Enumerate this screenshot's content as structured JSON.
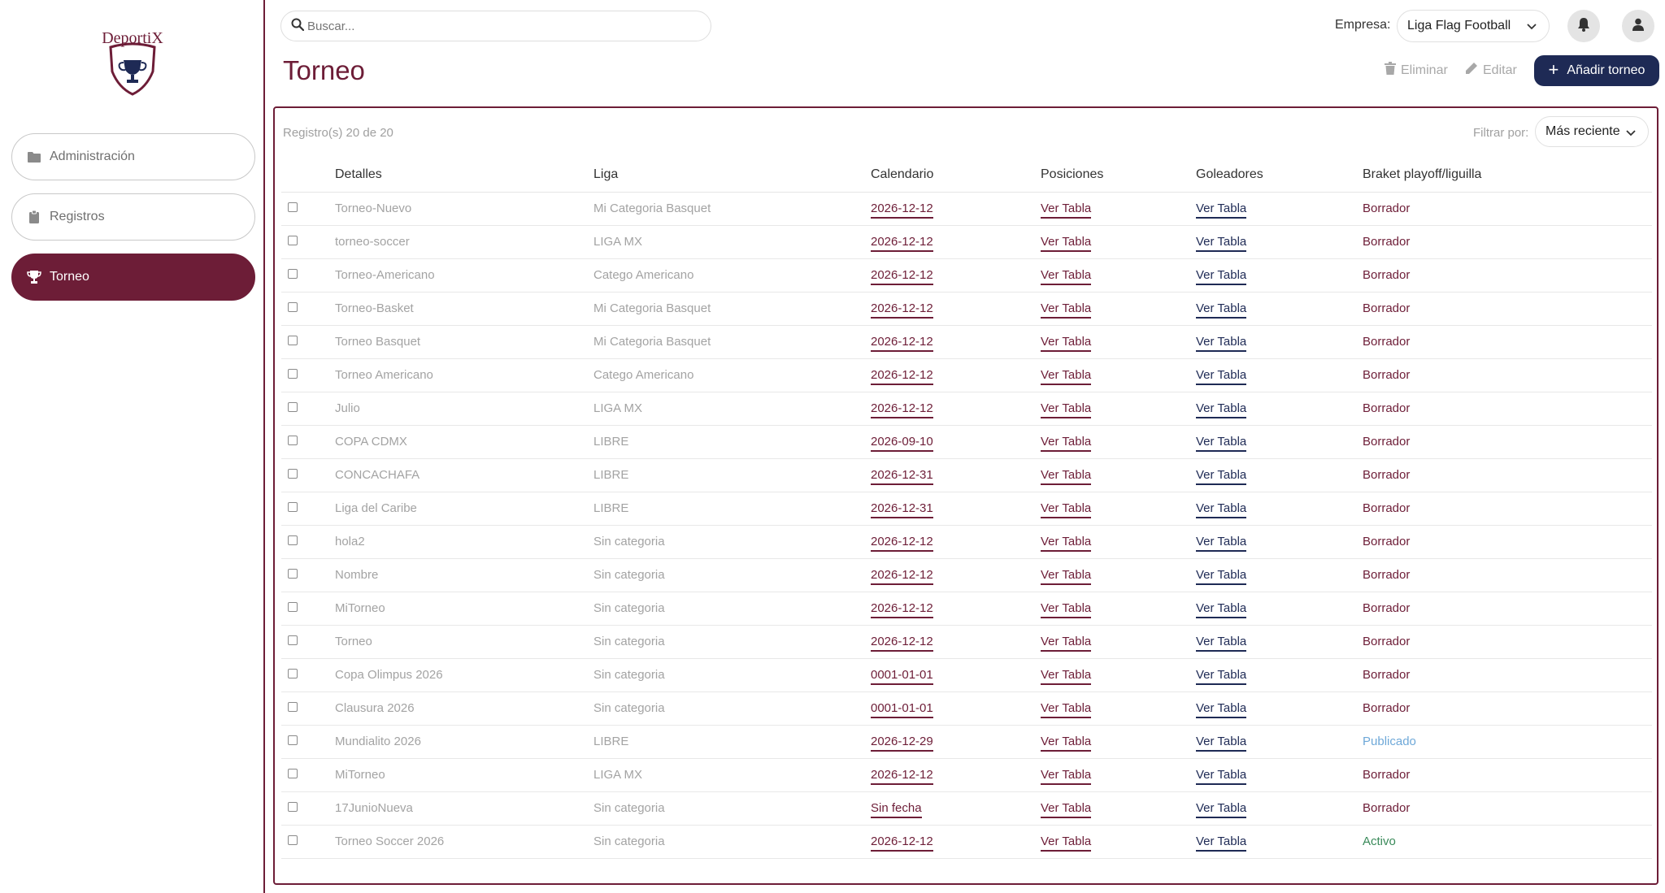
{
  "app": {
    "logo_text": "DeportiX"
  },
  "sidebar": {
    "items": [
      {
        "label": "Administración",
        "icon": "folder-icon"
      },
      {
        "label": "Registros",
        "icon": "clipboard-icon"
      },
      {
        "label": "Torneo",
        "icon": "trophy-icon"
      }
    ],
    "active": "Torneo"
  },
  "header": {
    "search_placeholder": "Buscar...",
    "empresa_label": "Empresa:",
    "empresa_value": "Liga Flag Football",
    "icons": [
      "bell-icon",
      "user-icon"
    ]
  },
  "page": {
    "title": "Torneo",
    "delete_label": "Eliminar",
    "edit_label": "Editar",
    "add_label": "Añadir torneo"
  },
  "table": {
    "count_text": "Registro(s) 20 de 20",
    "filter_label": "Filtrar por:",
    "filter_value": "Más reciente",
    "columns": [
      "Detalles",
      "Liga",
      "Calendario",
      "Posiciones",
      "Goleadores",
      "Braket playoff/liguilla"
    ],
    "rows": [
      {
        "detalles": "Torneo-Nuevo",
        "liga": "Mi Categoria Basquet",
        "calendario": "2026-12-12",
        "posiciones": "Ver Tabla",
        "goleadores": "Ver Tabla",
        "estado": "Borrador"
      },
      {
        "detalles": "torneo-soccer",
        "liga": "LIGA MX",
        "calendario": "2026-12-12",
        "posiciones": "Ver Tabla",
        "goleadores": "Ver Tabla",
        "estado": "Borrador"
      },
      {
        "detalles": "Torneo-Americano",
        "liga": "Catego Americano",
        "calendario": "2026-12-12",
        "posiciones": "Ver Tabla",
        "goleadores": "Ver Tabla",
        "estado": "Borrador"
      },
      {
        "detalles": "Torneo-Basket",
        "liga": "Mi Categoria Basquet",
        "calendario": "2026-12-12",
        "posiciones": "Ver Tabla",
        "goleadores": "Ver Tabla",
        "estado": "Borrador"
      },
      {
        "detalles": "Torneo Basquet",
        "liga": "Mi Categoria Basquet",
        "calendario": "2026-12-12",
        "posiciones": "Ver Tabla",
        "goleadores": "Ver Tabla",
        "estado": "Borrador"
      },
      {
        "detalles": "Torneo Americano",
        "liga": "Catego Americano",
        "calendario": "2026-12-12",
        "posiciones": "Ver Tabla",
        "goleadores": "Ver Tabla",
        "estado": "Borrador"
      },
      {
        "detalles": "Julio",
        "liga": "LIGA MX",
        "calendario": "2026-12-12",
        "posiciones": "Ver Tabla",
        "goleadores": "Ver Tabla",
        "estado": "Borrador"
      },
      {
        "detalles": "COPA CDMX",
        "liga": "LIBRE",
        "calendario": "2026-09-10",
        "posiciones": "Ver Tabla",
        "goleadores": "Ver Tabla",
        "estado": "Borrador"
      },
      {
        "detalles": "CONCACHAFA",
        "liga": "LIBRE",
        "calendario": "2026-12-31",
        "posiciones": "Ver Tabla",
        "goleadores": "Ver Tabla",
        "estado": "Borrador"
      },
      {
        "detalles": "Liga del Caribe",
        "liga": "LIBRE",
        "calendario": "2026-12-31",
        "posiciones": "Ver Tabla",
        "goleadores": "Ver Tabla",
        "estado": "Borrador"
      },
      {
        "detalles": "hola2",
        "liga": "Sin categoria",
        "calendario": "2026-12-12",
        "posiciones": "Ver Tabla",
        "goleadores": "Ver Tabla",
        "estado": "Borrador"
      },
      {
        "detalles": "Nombre",
        "liga": "Sin categoria",
        "calendario": "2026-12-12",
        "posiciones": "Ver Tabla",
        "goleadores": "Ver Tabla",
        "estado": "Borrador"
      },
      {
        "detalles": "MiTorneo",
        "liga": "Sin categoria",
        "calendario": "2026-12-12",
        "posiciones": "Ver Tabla",
        "goleadores": "Ver Tabla",
        "estado": "Borrador"
      },
      {
        "detalles": "Torneo",
        "liga": "Sin categoria",
        "calendario": "2026-12-12",
        "posiciones": "Ver Tabla",
        "goleadores": "Ver Tabla",
        "estado": "Borrador"
      },
      {
        "detalles": "Copa Olimpus 2026",
        "liga": "Sin categoria",
        "calendario": "0001-01-01",
        "posiciones": "Ver Tabla",
        "goleadores": "Ver Tabla",
        "estado": "Borrador"
      },
      {
        "detalles": "Clausura 2026",
        "liga": "Sin categoria",
        "calendario": "0001-01-01",
        "posiciones": "Ver Tabla",
        "goleadores": "Ver Tabla",
        "estado": "Borrador"
      },
      {
        "detalles": "Mundialito 2026",
        "liga": "LIBRE",
        "calendario": "2026-12-29",
        "posiciones": "Ver Tabla",
        "goleadores": "Ver Tabla",
        "estado": "Publicado"
      },
      {
        "detalles": "MiTorneo",
        "liga": "LIGA MX",
        "calendario": "2026-12-12",
        "posiciones": "Ver Tabla",
        "goleadores": "Ver Tabla",
        "estado": "Borrador"
      },
      {
        "detalles": "17JunioNueva",
        "liga": "Sin categoria",
        "calendario": "Sin fecha",
        "posiciones": "Ver Tabla",
        "goleadores": "Ver Tabla",
        "estado": "Borrador"
      },
      {
        "detalles": "Torneo Soccer 2026",
        "liga": "Sin categoria",
        "calendario": "2026-12-12",
        "posiciones": "Ver Tabla",
        "goleadores": "Ver Tabla",
        "estado": "Activo"
      }
    ]
  },
  "colors": {
    "brand": "#6d1d37",
    "navy": "#1e2a55",
    "status_publicado": "#6ea8d8",
    "status_activo": "#3a8a5a",
    "status_borrador": "#6d1d37"
  }
}
